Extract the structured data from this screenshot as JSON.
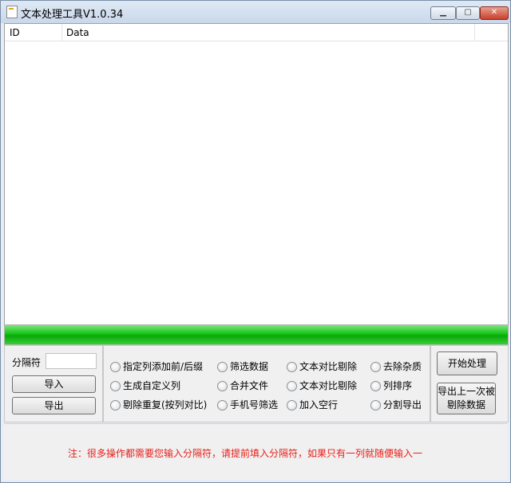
{
  "window": {
    "title": "文本处理工具V1.0.34",
    "minimize_label": "▁",
    "maximize_label": "▢",
    "close_label": "✕"
  },
  "table": {
    "columns": [
      "ID",
      "Data"
    ],
    "rows": []
  },
  "progress": {
    "value": 1.0,
    "color": "#16c416"
  },
  "left_panel": {
    "separator_label": "分隔符",
    "separator_value": "",
    "import_label": "导入",
    "export_label": "导出"
  },
  "options": [
    "指定列添加前/后缀",
    "筛选数据",
    "文本对比剔除",
    "去除杂质",
    "生成自定义列",
    "合并文件",
    "文本对比剔除",
    "列排序",
    "剔除重复(按列对比)",
    "手机号筛选",
    "加入空行",
    "分割导出"
  ],
  "actions": {
    "start_label": "开始处理",
    "redo_label_line1": "导出上一次被",
    "redo_label_line2": "剔除数据"
  },
  "note": {
    "text": "注：很多操作都需要您输入分隔符，请提前填入分隔符，如果只有一列就随便输入一",
    "color": "#e8201a"
  }
}
